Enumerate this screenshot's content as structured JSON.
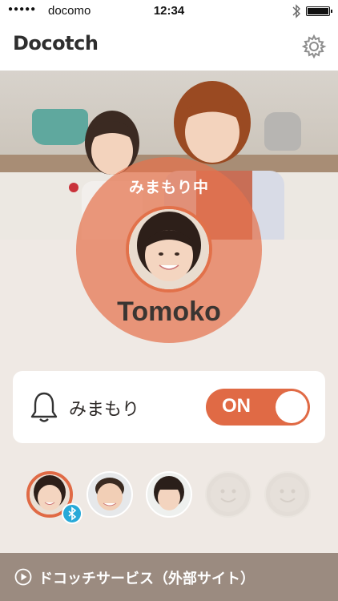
{
  "status_bar": {
    "signal": "●●●●●",
    "carrier": "docomo",
    "time": "12:34"
  },
  "nav": {
    "logo": "Docotch",
    "settings_icon": "gear-icon"
  },
  "hero": {
    "watch_status": "みまもり中"
  },
  "child": {
    "name": "Tomoko"
  },
  "watch_card": {
    "icon": "bell-icon",
    "label": "みまもり",
    "toggle": "ON",
    "toggle_color": "#e06a45"
  },
  "members": [
    {
      "slot": "child-1",
      "selected": true,
      "bluetooth": true
    },
    {
      "slot": "child-2",
      "selected": false
    },
    {
      "slot": "child-3",
      "selected": false
    },
    {
      "slot": "empty-1",
      "empty": true
    },
    {
      "slot": "empty-2",
      "empty": true
    }
  ],
  "footer": {
    "icon": "play-circle-icon",
    "label": "ドコッチサービス（外部サイト）"
  },
  "colors": {
    "accent": "#e06a45",
    "background": "#efe9e4",
    "footer": "#9b8b80",
    "bluetooth": "#27a9d8"
  }
}
